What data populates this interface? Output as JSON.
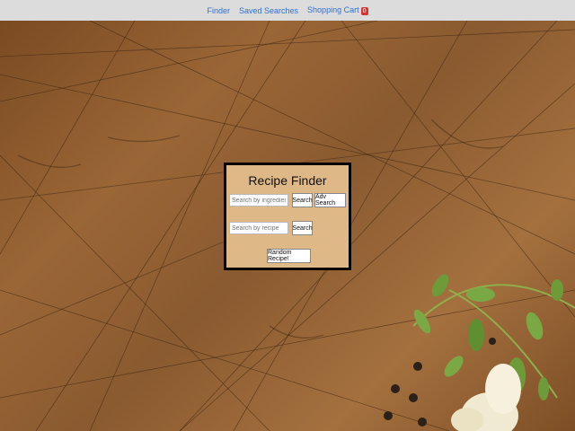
{
  "nav": {
    "finder": "Finder",
    "saved_searches": "Saved Searches",
    "shopping_cart": "Shopping Cart",
    "cart_count": "0"
  },
  "panel": {
    "title": "Recipe Finder",
    "ingredient_placeholder": "Search by ingredient",
    "search_label": "Search",
    "adv_search_label": "Adv Search",
    "recipe_placeholder": "Search by recipe",
    "search2_label": "Search",
    "random_label": "Random Recipe!"
  },
  "colors": {
    "nav_bg": "#dcdcdc",
    "link": "#2f6fd6",
    "panel_bg": "#deb887",
    "badge": "#d9332f"
  }
}
